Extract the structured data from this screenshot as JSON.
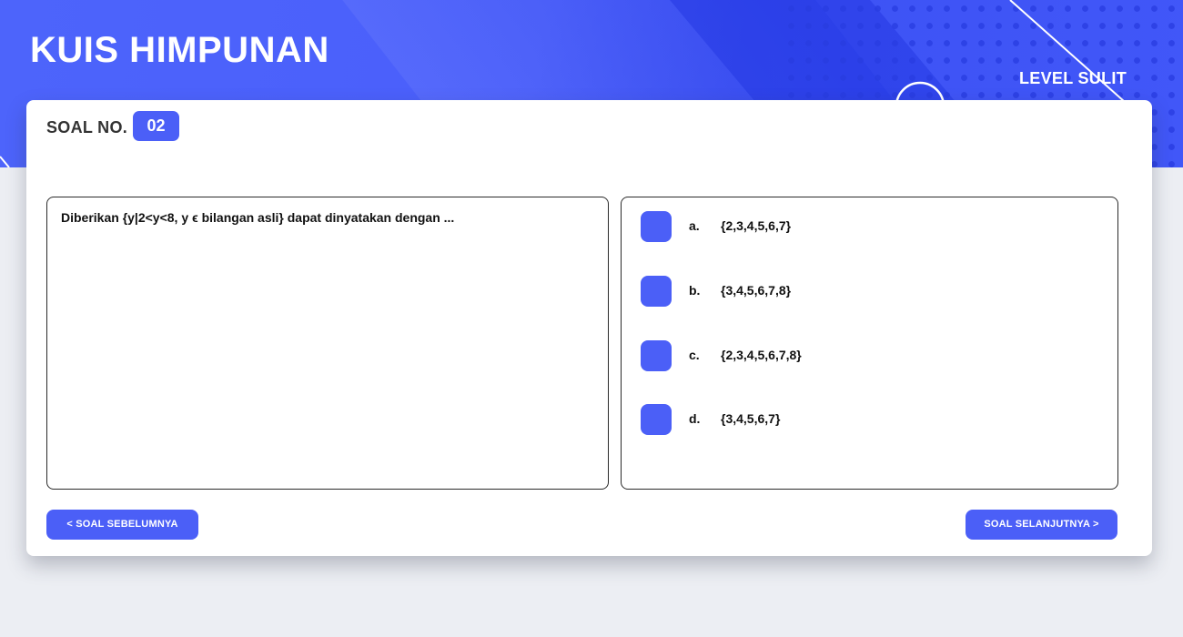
{
  "header": {
    "title": "KUIS HIMPUNAN",
    "level": "LEVEL SULIT"
  },
  "question": {
    "label": "SOAL NO.",
    "number": "02",
    "text": "Diberikan {y|2<y<8, y ϵ bilangan asli} dapat dinyatakan dengan ..."
  },
  "options": [
    {
      "letter": "a.",
      "value": "{2,3,4,5,6,7}"
    },
    {
      "letter": "b.",
      "value": "{3,4,5,6,7,8}"
    },
    {
      "letter": "c.",
      "value": "{2,3,4,5,6,7,8}"
    },
    {
      "letter": "d.",
      "value": "{3,4,5,6,7}"
    }
  ],
  "nav": {
    "prev_label": "< SOAL SEBELUMNYA",
    "next_label": "SOAL SELANJUTNYA >"
  },
  "colors": {
    "accent": "#4b5ff7",
    "header_bg": "#4a5ffb",
    "page_bg": "#eceef3"
  }
}
